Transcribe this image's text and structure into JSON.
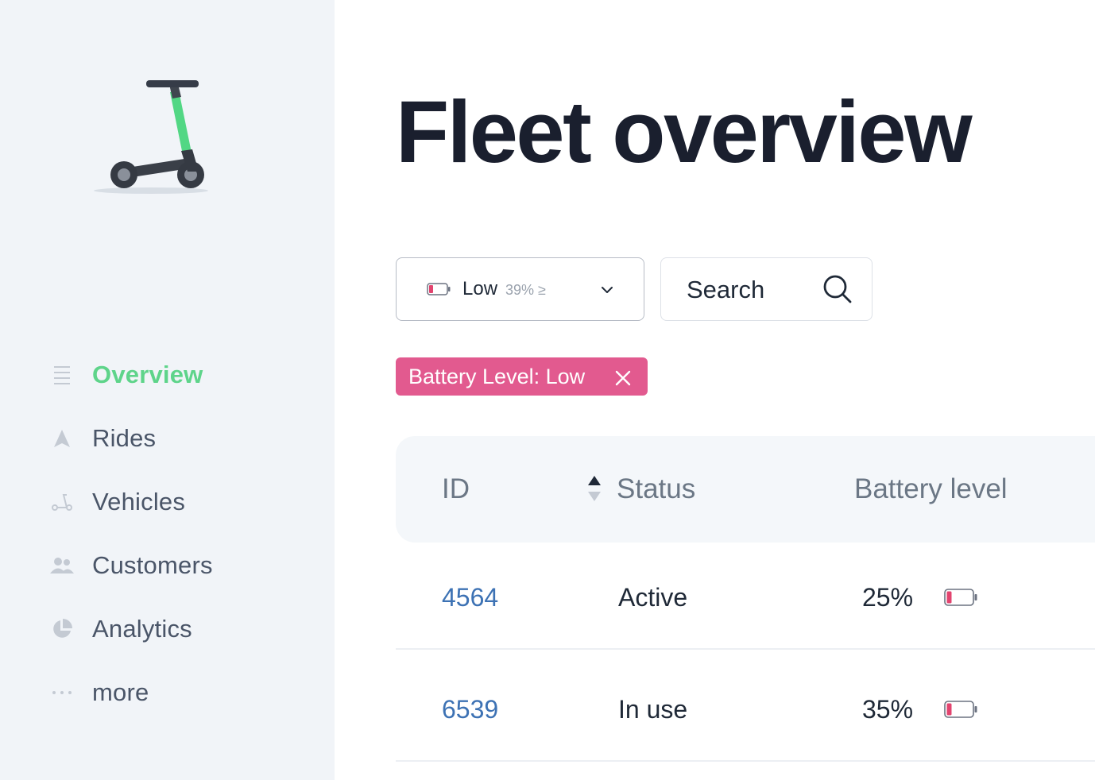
{
  "sidebar": {
    "logo": "scooter-logo",
    "items": [
      {
        "label": "Overview",
        "icon": "list-icon",
        "active": true
      },
      {
        "label": "Rides",
        "icon": "navigation-arrow-icon",
        "active": false
      },
      {
        "label": "Vehicles",
        "icon": "scooter-icon",
        "active": false
      },
      {
        "label": "Customers",
        "icon": "users-icon",
        "active": false
      },
      {
        "label": "Analytics",
        "icon": "pie-chart-icon",
        "active": false
      },
      {
        "label": "more",
        "icon": "ellipsis-icon",
        "active": false
      }
    ]
  },
  "main": {
    "title": "Fleet overview",
    "filter": {
      "selected": "Low",
      "hint": "39% ≥",
      "icon": "battery-low-icon"
    },
    "search": {
      "placeholder": "Search",
      "icon": "search-icon"
    },
    "active_filter_chip": {
      "label": "Battery Level: Low",
      "close_icon": "close-icon"
    },
    "table": {
      "columns": [
        "ID",
        "Status",
        "Battery level"
      ],
      "rows": [
        {
          "id": "4564",
          "status": "Active",
          "battery": "25%",
          "battery_fraction": 0.25
        },
        {
          "id": "6539",
          "status": "In use",
          "battery": "35%",
          "battery_fraction": 0.35
        }
      ]
    }
  },
  "colors": {
    "sidebar_bg": "#f1f4f8",
    "active_nav": "#5ed48a",
    "chip_bg": "#e25a8f",
    "id_link": "#3d72b4",
    "battery_low": "#e2446f",
    "title": "#1a1f2e"
  }
}
